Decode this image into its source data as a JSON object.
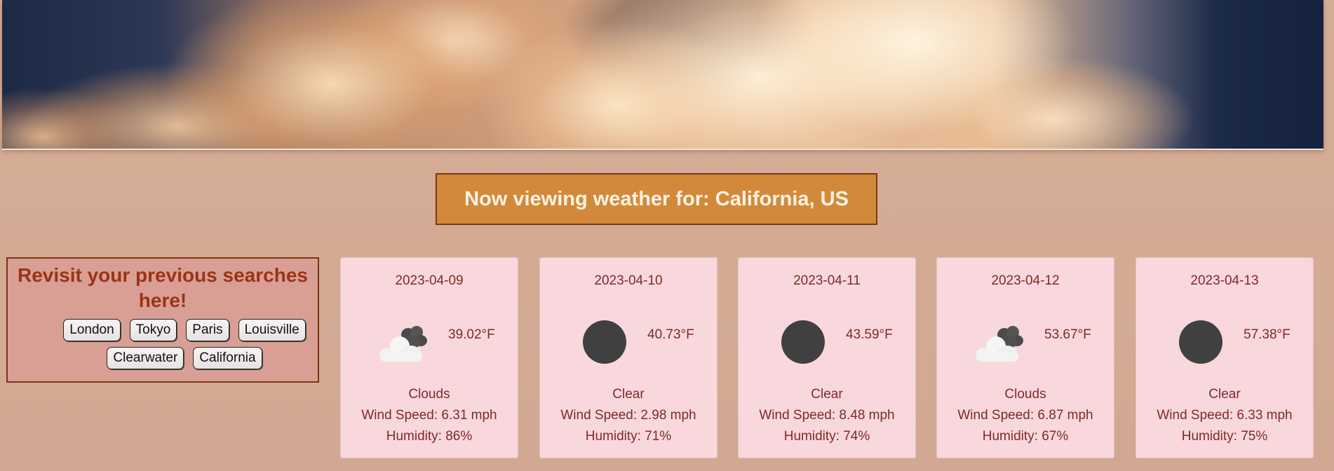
{
  "header": {
    "title": "Now viewing weather for: California, US"
  },
  "history": {
    "heading": "Revisit your previous searches here!",
    "cities": [
      "London",
      "Tokyo",
      "Paris",
      "Louisville",
      "Clearwater",
      "California"
    ]
  },
  "forecast": [
    {
      "date": "2023-04-09",
      "icon": "clouds-icon",
      "temp": "39.02°F",
      "description": "Clouds",
      "wind": "Wind Speed: 6.31 mph",
      "humidity": "Humidity: 86%"
    },
    {
      "date": "2023-04-10",
      "icon": "clear-icon",
      "temp": "40.73°F",
      "description": "Clear",
      "wind": "Wind Speed: 2.98 mph",
      "humidity": "Humidity: 71%"
    },
    {
      "date": "2023-04-11",
      "icon": "clear-icon",
      "temp": "43.59°F",
      "description": "Clear",
      "wind": "Wind Speed: 8.48 mph",
      "humidity": "Humidity: 74%"
    },
    {
      "date": "2023-04-12",
      "icon": "clouds-icon",
      "temp": "53.67°F",
      "description": "Clouds",
      "wind": "Wind Speed: 6.87 mph",
      "humidity": "Humidity: 67%"
    },
    {
      "date": "2023-04-13",
      "icon": "clear-icon",
      "temp": "57.38°F",
      "description": "Clear",
      "wind": "Wind Speed: 6.33 mph",
      "humidity": "Humidity: 75%"
    }
  ],
  "colors": {
    "background": "#d6ad95",
    "title_bg": "#d28a3a",
    "title_border": "#7e3617",
    "history_bg": "#d99f94",
    "history_text": "#9b3317",
    "card_bg": "#f8d8dc",
    "card_text": "#7d2a2a"
  }
}
